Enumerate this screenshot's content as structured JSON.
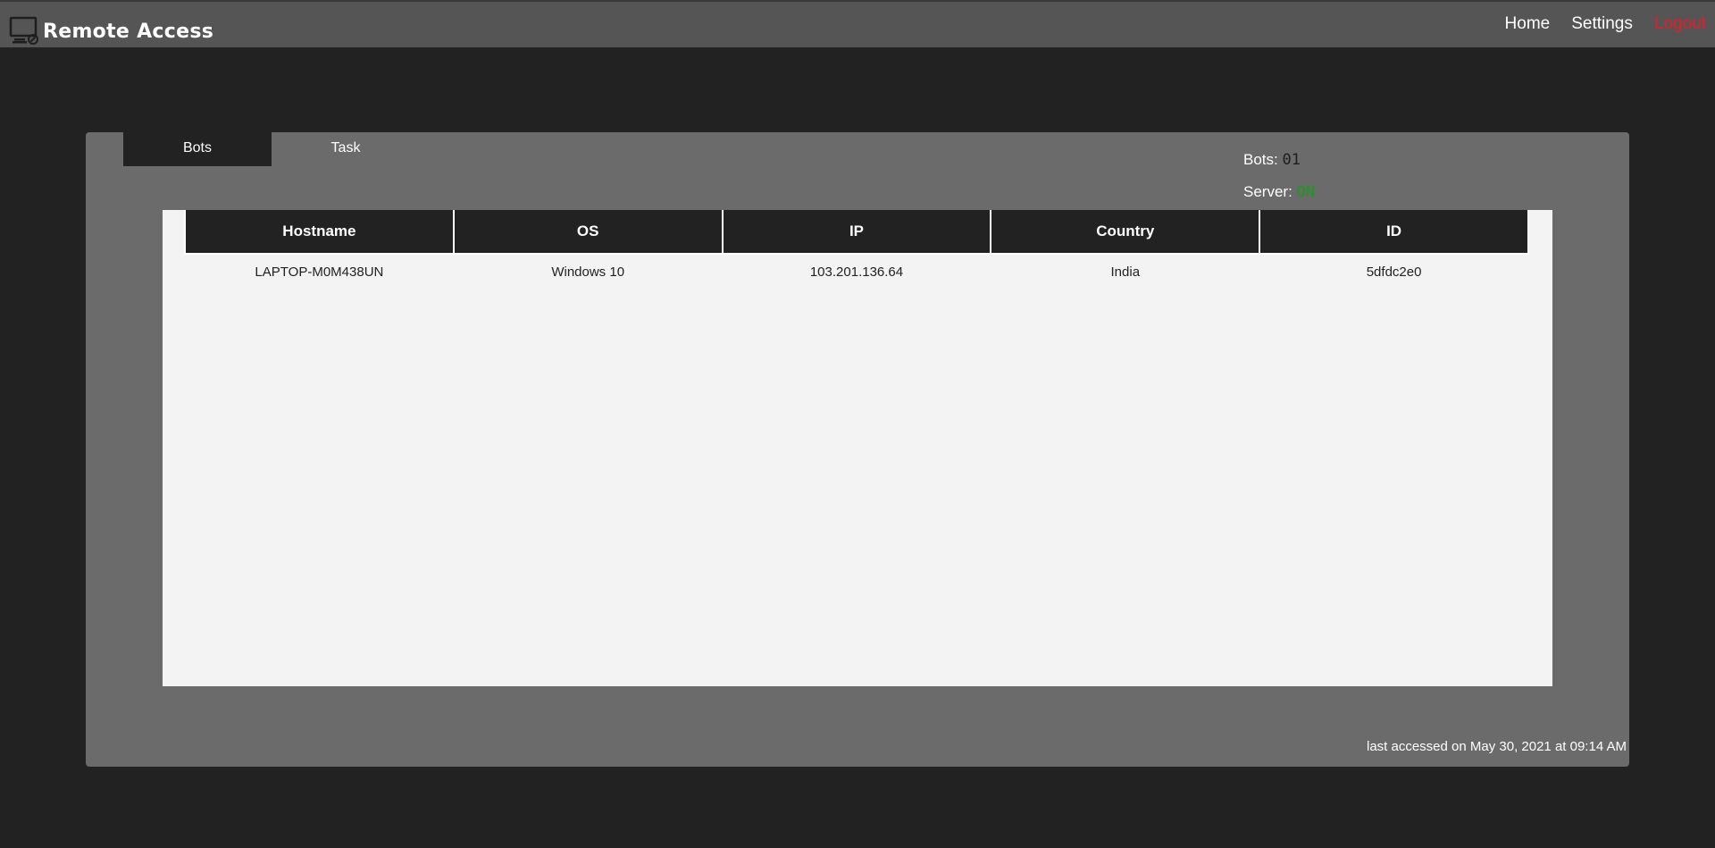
{
  "header": {
    "title": "Remote Access",
    "icon": "monitor-icon",
    "nav": {
      "home": "Home",
      "settings": "Settings",
      "logout": "Logout"
    }
  },
  "tabs": {
    "bots": "Bots",
    "task": "Task"
  },
  "stats": {
    "bots_label": "Bots:",
    "bots_value": "01",
    "server_label": "Server:",
    "server_value": "ON"
  },
  "table": {
    "columns": [
      "Hostname",
      "OS",
      "IP",
      "Country",
      "ID"
    ],
    "rows": [
      [
        "LAPTOP-M0M438UN",
        "Windows 10",
        "103.201.136.64",
        "India",
        "5dfdc2e0"
      ]
    ]
  },
  "footer": {
    "last_accessed": "last accessed on May 30, 2021 at 09:14 AM"
  },
  "colors": {
    "logout": "#e41c2b",
    "server_on": "#1b9a1b",
    "active_tab": "#222222"
  }
}
